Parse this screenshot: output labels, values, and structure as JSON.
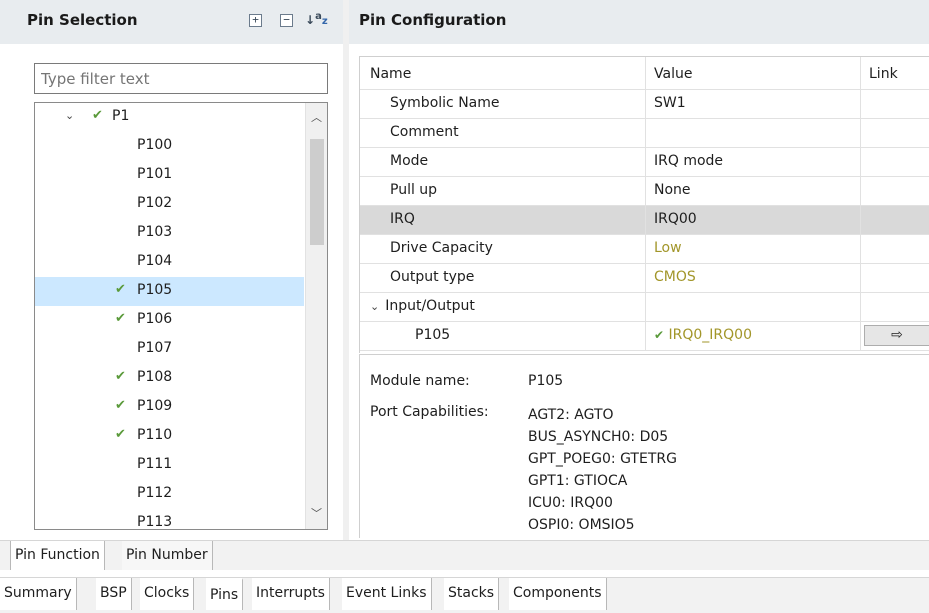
{
  "pin_selection": {
    "title": "Pin Selection",
    "icons": [
      "expand-all-icon",
      "collapse-all-icon",
      "sort-az-icon"
    ],
    "filter_placeholder": "Type filter text",
    "tree": [
      {
        "label": "P1",
        "checked": true,
        "expanded": true,
        "level": 0,
        "selected": false
      },
      {
        "label": "P100",
        "checked": false,
        "level": 1,
        "selected": false
      },
      {
        "label": "P101",
        "checked": false,
        "level": 1,
        "selected": false
      },
      {
        "label": "P102",
        "checked": false,
        "level": 1,
        "selected": false
      },
      {
        "label": "P103",
        "checked": false,
        "level": 1,
        "selected": false
      },
      {
        "label": "P104",
        "checked": false,
        "level": 1,
        "selected": false
      },
      {
        "label": "P105",
        "checked": true,
        "level": 1,
        "selected": true
      },
      {
        "label": "P106",
        "checked": true,
        "level": 1,
        "selected": false
      },
      {
        "label": "P107",
        "checked": false,
        "level": 1,
        "selected": false
      },
      {
        "label": "P108",
        "checked": true,
        "level": 1,
        "selected": false
      },
      {
        "label": "P109",
        "checked": true,
        "level": 1,
        "selected": false
      },
      {
        "label": "P110",
        "checked": true,
        "level": 1,
        "selected": false
      },
      {
        "label": "P111",
        "checked": false,
        "level": 1,
        "selected": false
      },
      {
        "label": "P112",
        "checked": false,
        "level": 1,
        "selected": false
      },
      {
        "label": "P113",
        "checked": false,
        "level": 1,
        "selected": false
      }
    ]
  },
  "pin_configuration": {
    "title": "Pin Configuration",
    "columns": [
      "Name",
      "Value",
      "Link"
    ],
    "rows": [
      {
        "name": "Symbolic Name",
        "value": "SW1",
        "indent": 1
      },
      {
        "name": "Comment",
        "value": "",
        "indent": 1
      },
      {
        "name": "Mode",
        "value": "IRQ mode",
        "indent": 1
      },
      {
        "name": "Pull up",
        "value": "None",
        "indent": 1
      },
      {
        "name": "IRQ",
        "value": "IRQ00",
        "indent": 1,
        "highlight": true
      },
      {
        "name": "Drive Capacity",
        "value": "Low",
        "indent": 1,
        "value_color": "#a2962a"
      },
      {
        "name": "Output type",
        "value": "CMOS",
        "indent": 1,
        "value_color": "#a2962a"
      },
      {
        "name": "Input/Output",
        "value": "",
        "indent": 0,
        "expander": true
      },
      {
        "name": "P105",
        "value": "IRQ0_IRQ00",
        "indent": 2,
        "value_color": "#a2962a",
        "value_check": true,
        "link_button": true
      }
    ],
    "link_button_icon": "arrow-right-icon",
    "details": {
      "module_label": "Module name:",
      "module_value": "P105",
      "capabilities_label": "Port Capabilities:",
      "capabilities": [
        "AGT2: AGTO",
        "BUS_ASYNCH0: D05",
        "GPT_POEG0: GTETRG",
        "GPT1: GTIOCA",
        "ICU0: IRQ00",
        "OSPI0: OMSIO5"
      ]
    }
  },
  "bottom_tabs": [
    "Pin Function",
    "Pin Number"
  ],
  "editor_tabs": [
    "Summary",
    "BSP",
    "Clocks",
    "Pins",
    "Interrupts",
    "Event Links",
    "Stacks",
    "Components"
  ],
  "active_editor_tab": "Pins",
  "colors": {
    "check": "#5a9a3a",
    "olive_value": "#a2962a",
    "selection": "#cce8ff",
    "header_bg": "#e8ecef"
  }
}
